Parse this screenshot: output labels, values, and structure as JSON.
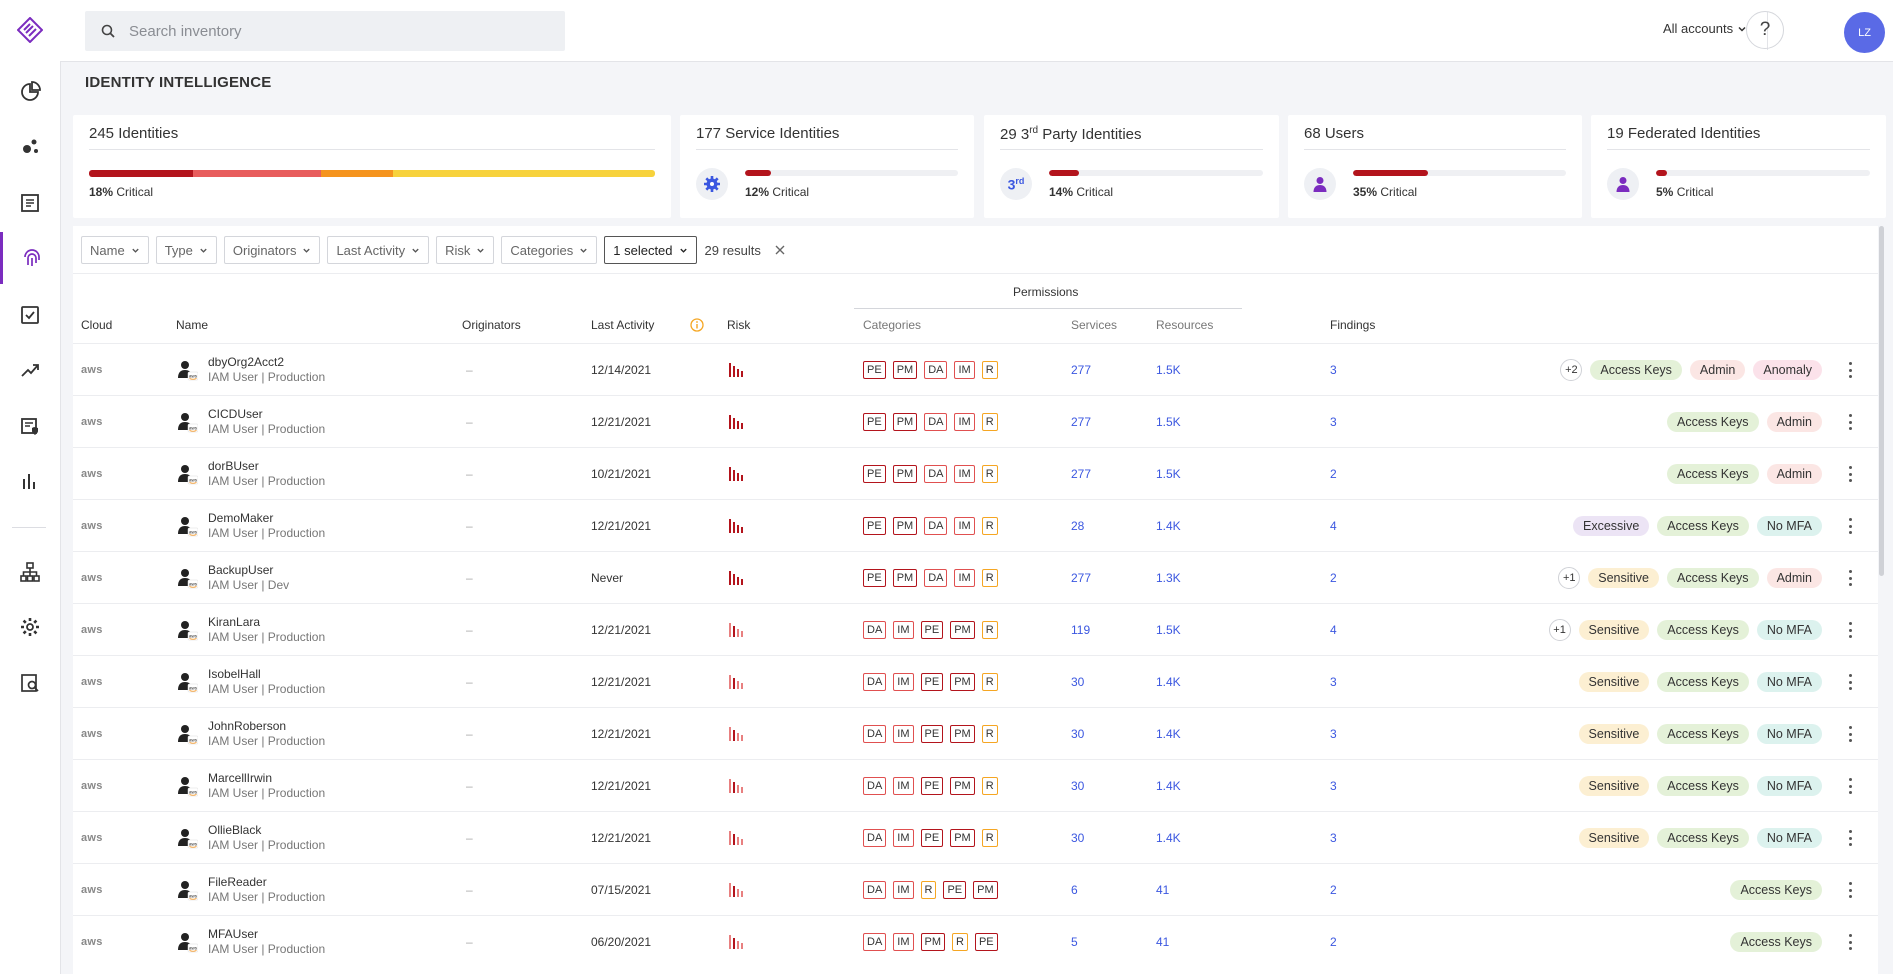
{
  "search": {
    "placeholder": "Search inventory"
  },
  "header": {
    "accounts_label": "All accounts",
    "help_label": "?",
    "avatar_initials": "LZ"
  },
  "page_title": "IDENTITY INTELLIGENCE",
  "summary_cards": [
    {
      "count_label": "245 Identities",
      "critical_pct": "18%",
      "critical_label": "Critical",
      "segments": [
        0.183,
        0.227,
        0.128,
        0.462
      ],
      "segment_colors": [
        "#b3141c",
        "#e85d5d",
        "#f5941e",
        "#f7d23c"
      ]
    },
    {
      "count_label": "177 Service Identities",
      "critical_pct": "12%",
      "critical_label": "Critical",
      "fill": 0.12,
      "icon": "gear-icon"
    },
    {
      "count_prefix": "29 3",
      "count_sup": "rd",
      "count_suffix": " Party Identities",
      "critical_pct": "14%",
      "critical_label": "Critical",
      "fill": 0.14,
      "icon_text": "3",
      "icon_sup": "rd"
    },
    {
      "count_label": "68 Users",
      "critical_pct": "35%",
      "critical_label": "Critical",
      "fill": 0.35,
      "icon": "user-icon"
    },
    {
      "count_label": "19 Federated Identities",
      "critical_pct": "5%",
      "critical_label": "Critical",
      "fill": 0.05,
      "icon": "user-icon"
    }
  ],
  "filters": [
    "Name",
    "Type",
    "Originators",
    "Last Activity",
    "Risk",
    "Categories"
  ],
  "selected_filter": "1 selected",
  "results_label": "29 results",
  "permissions_header": "Permissions",
  "columns": {
    "cloud": "Cloud",
    "name": "Name",
    "originators": "Originators",
    "last_activity": "Last Activity",
    "risk": "Risk",
    "categories": "Categories",
    "services": "Services",
    "resources": "Resources",
    "findings": "Findings"
  },
  "category_colors": {
    "PE": "#b3141c",
    "PM": "#b3141c",
    "DA": "#e05050",
    "IM": "#e05050",
    "R": "#f5a623"
  },
  "badge_colors": {
    "Access Keys": "#e4f1d8",
    "Admin": "#fbe6e4",
    "Anomaly": "#fbe2ea",
    "Excessive": "#ece4f5",
    "No MFA": "#dcf2ee",
    "Sensitive": "#fcefd2"
  },
  "rows": [
    {
      "cloud": "aws",
      "name": "dbyOrg2Acct2",
      "sub": "IAM User | Production",
      "originators": "–",
      "last_activity": "12/14/2021",
      "risk": "high",
      "categories": [
        "PE",
        "PM",
        "DA",
        "IM",
        "R"
      ],
      "services": "277",
      "resources": "1.5K",
      "findings": "3",
      "extra": "+2",
      "badges": [
        "Access Keys",
        "Admin",
        "Anomaly"
      ]
    },
    {
      "cloud": "aws",
      "name": "CICDUser",
      "sub": "IAM User | Production",
      "originators": "–",
      "last_activity": "12/21/2021",
      "risk": "high",
      "categories": [
        "PE",
        "PM",
        "DA",
        "IM",
        "R"
      ],
      "services": "277",
      "resources": "1.5K",
      "findings": "3",
      "extra": "",
      "badges": [
        "Access Keys",
        "Admin"
      ]
    },
    {
      "cloud": "aws",
      "name": "dorBUser",
      "sub": "IAM User | Production",
      "originators": "–",
      "last_activity": "10/21/2021",
      "risk": "high",
      "categories": [
        "PE",
        "PM",
        "DA",
        "IM",
        "R"
      ],
      "services": "277",
      "resources": "1.5K",
      "findings": "2",
      "extra": "",
      "badges": [
        "Access Keys",
        "Admin"
      ]
    },
    {
      "cloud": "aws",
      "name": "DemoMaker",
      "sub": "IAM User | Production",
      "originators": "–",
      "last_activity": "12/21/2021",
      "risk": "high",
      "categories": [
        "PE",
        "PM",
        "DA",
        "IM",
        "R"
      ],
      "services": "28",
      "resources": "1.4K",
      "findings": "4",
      "extra": "",
      "badges": [
        "Excessive",
        "Access Keys",
        "No MFA"
      ]
    },
    {
      "cloud": "aws",
      "name": "BackupUser",
      "sub": "IAM User | Dev",
      "originators": "–",
      "last_activity": "Never",
      "risk": "high",
      "categories": [
        "PE",
        "PM",
        "DA",
        "IM",
        "R"
      ],
      "services": "277",
      "resources": "1.3K",
      "findings": "2",
      "extra": "+1",
      "badges": [
        "Sensitive",
        "Access Keys",
        "Admin"
      ]
    },
    {
      "cloud": "aws",
      "name": "KiranLara",
      "sub": "IAM User | Production",
      "originators": "–",
      "last_activity": "12/21/2021",
      "risk": "medium",
      "categories": [
        "DA",
        "IM",
        "PE",
        "PM",
        "R"
      ],
      "services": "119",
      "resources": "1.5K",
      "findings": "4",
      "extra": "+1",
      "badges": [
        "Sensitive",
        "Access Keys",
        "No MFA"
      ]
    },
    {
      "cloud": "aws",
      "name": "IsobelHall",
      "sub": "IAM User | Production",
      "originators": "–",
      "last_activity": "12/21/2021",
      "risk": "medium",
      "categories": [
        "DA",
        "IM",
        "PE",
        "PM",
        "R"
      ],
      "services": "30",
      "resources": "1.4K",
      "findings": "3",
      "extra": "",
      "badges": [
        "Sensitive",
        "Access Keys",
        "No MFA"
      ]
    },
    {
      "cloud": "aws",
      "name": "JohnRoberson",
      "sub": "IAM User | Production",
      "originators": "–",
      "last_activity": "12/21/2021",
      "risk": "medium",
      "categories": [
        "DA",
        "IM",
        "PE",
        "PM",
        "R"
      ],
      "services": "30",
      "resources": "1.4K",
      "findings": "3",
      "extra": "",
      "badges": [
        "Sensitive",
        "Access Keys",
        "No MFA"
      ]
    },
    {
      "cloud": "aws",
      "name": "MarcellIrwin",
      "sub": "IAM User | Production",
      "originators": "–",
      "last_activity": "12/21/2021",
      "risk": "medium",
      "categories": [
        "DA",
        "IM",
        "PE",
        "PM",
        "R"
      ],
      "services": "30",
      "resources": "1.4K",
      "findings": "3",
      "extra": "",
      "badges": [
        "Sensitive",
        "Access Keys",
        "No MFA"
      ]
    },
    {
      "cloud": "aws",
      "name": "OllieBlack",
      "sub": "IAM User | Production",
      "originators": "–",
      "last_activity": "12/21/2021",
      "risk": "medium",
      "categories": [
        "DA",
        "IM",
        "PE",
        "PM",
        "R"
      ],
      "services": "30",
      "resources": "1.4K",
      "findings": "3",
      "extra": "",
      "badges": [
        "Sensitive",
        "Access Keys",
        "No MFA"
      ]
    },
    {
      "cloud": "aws",
      "name": "FileReader",
      "sub": "IAM User | Production",
      "originators": "–",
      "last_activity": "07/15/2021",
      "risk": "medium",
      "categories": [
        "DA",
        "IM",
        "R",
        "PE",
        "PM"
      ],
      "services": "6",
      "resources": "41",
      "findings": "2",
      "extra": "",
      "badges": [
        "Access Keys"
      ]
    },
    {
      "cloud": "aws",
      "name": "MFAUser",
      "sub": "IAM User | Production",
      "originators": "–",
      "last_activity": "06/20/2021",
      "risk": "medium",
      "categories": [
        "DA",
        "IM",
        "PM",
        "R",
        "PE"
      ],
      "services": "5",
      "resources": "41",
      "findings": "2",
      "extra": "",
      "badges": [
        "Access Keys"
      ]
    }
  ]
}
